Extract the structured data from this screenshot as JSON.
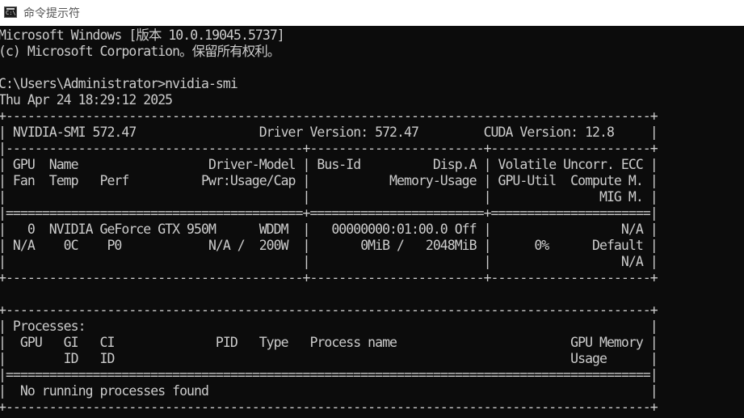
{
  "window": {
    "title": "命令提示符",
    "icon": "cmd-icon"
  },
  "console": {
    "lines": [
      "Microsoft Windows [版本 10.0.19045.5737]",
      "(c) Microsoft Corporation。保留所有权利。",
      "",
      "C:\\Users\\Administrator>nvidia-smi",
      "Thu Apr 24 18:29:12 2025",
      "+-----------------------------------------------------------------------------------------+",
      "| NVIDIA-SMI 572.47                 Driver Version: 572.47         CUDA Version: 12.8     |",
      "|-----------------------------------------+------------------------+----------------------+",
      "| GPU  Name                  Driver-Model | Bus-Id          Disp.A | Volatile Uncorr. ECC |",
      "| Fan  Temp   Perf          Pwr:Usage/Cap |           Memory-Usage | GPU-Util  Compute M. |",
      "|                                         |                        |               MIG M. |",
      "|=========================================+========================+======================|",
      "|   0  NVIDIA GeForce GTX 950M      WDDM  |   00000000:01:00.0 Off |                  N/A |",
      "| N/A    0C    P0            N/A /  200W  |       0MiB /   2048MiB |      0%      Default |",
      "|                                         |                        |                  N/A |",
      "+-----------------------------------------+------------------------+----------------------+",
      "",
      "+-----------------------------------------------------------------------------------------+",
      "| Processes:                                                                              |",
      "|  GPU   GI   CI              PID   Type   Process name                        GPU Memory |",
      "|        ID   ID                                                               Usage      |",
      "|=========================================================================================|",
      "|  No running processes found                                                             |",
      "+-----------------------------------------------------------------------------------------+"
    ]
  }
}
